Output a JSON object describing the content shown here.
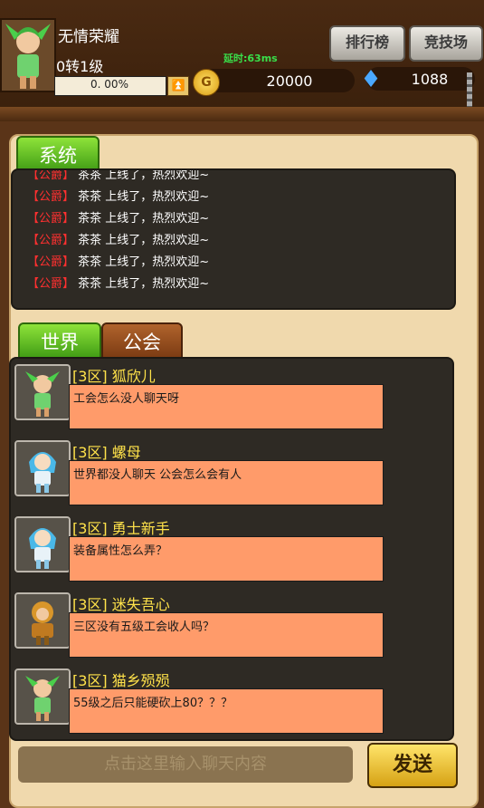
{
  "player": {
    "name": "无情荣耀",
    "level": "0转1级",
    "exp": "0. 00%",
    "latency": "延时:63ms",
    "gold": "20000",
    "diamonds": "1088",
    "up_icon": "⏫",
    "coin_glyph": "G"
  },
  "top_buttons": {
    "rank": "排行榜",
    "arena": "竞技场"
  },
  "tabs": {
    "system": "系统",
    "world": "世界",
    "guild": "公会"
  },
  "system_messages": [
    {
      "tag": "【公爵】",
      "text": "茶茶 上线了，热烈欢迎~"
    },
    {
      "tag": "【公爵】",
      "text": "茶茶 上线了，热烈欢迎~"
    },
    {
      "tag": "【公爵】",
      "text": "茶茶 上线了，热烈欢迎~"
    },
    {
      "tag": "【公爵】",
      "text": "茶茶 上线了，热烈欢迎~"
    },
    {
      "tag": "【公爵】",
      "text": "茶茶 上线了，热烈欢迎~"
    },
    {
      "tag": "【公爵】",
      "text": "茶茶 上线了，热烈欢迎~"
    }
  ],
  "chat_messages": [
    {
      "name": "[3区] 狐欣儿",
      "text": "工会怎么没人聊天呀",
      "avatar": "green-elf-icon"
    },
    {
      "name": "[3区] 螺母",
      "text": "世界都没人聊天 公会怎么会有人",
      "avatar": "blue-mage-icon"
    },
    {
      "name": "[3区] 勇士新手",
      "text": "装备属性怎么弄？",
      "avatar": "blue-mage-icon"
    },
    {
      "name": "[3区] 迷失吾心",
      "text": "三区没有五级工会收人吗？",
      "avatar": "monkey-warrior-icon"
    },
    {
      "name": "[3区] 猫乡殒殒",
      "text": "55级之后只能硬砍上80？？？",
      "avatar": "green-elf-icon"
    }
  ],
  "input": {
    "placeholder": "点击这里输入聊天内容"
  },
  "send_label": "发送"
}
